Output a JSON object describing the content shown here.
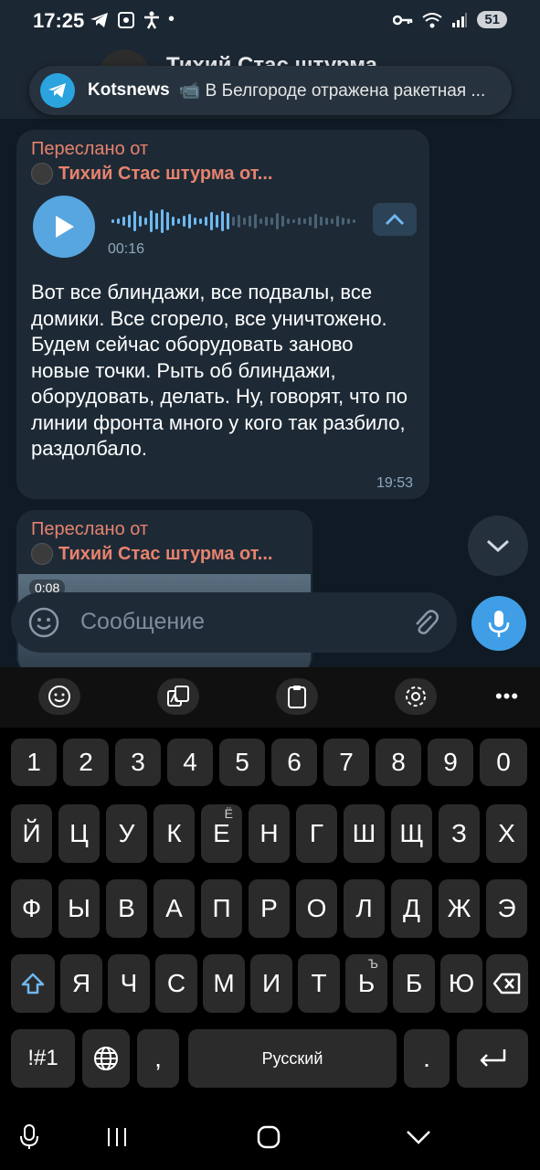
{
  "status": {
    "time": "17:25",
    "battery": "51"
  },
  "header": {
    "title": "Тихий Стас штурма..."
  },
  "notification": {
    "app": "Kotsnews",
    "text": "📹 В Белгороде отражена ракетная ..."
  },
  "messages": [
    {
      "forwarded_label": "Переслано от",
      "source": "Тихий Стас штурма от...",
      "voice_duration": "00:16",
      "text": "Вот все блиндажи, все подвалы, все домики. Все сгорело, все уничтожено. Будем сейчас оборудовать заново новые точки. Рыть об блиндажи, оборудовать, делать. Ну, говорят, что по линии фронта много у кого так разбило, раздолбало.",
      "time": "19:53"
    },
    {
      "forwarded_label": "Переслано от",
      "source": "Тихий Стас штурма от...",
      "video_duration": "0:08"
    }
  ],
  "input": {
    "placeholder": "Сообщение"
  },
  "keyboard": {
    "number_row": [
      "1",
      "2",
      "3",
      "4",
      "5",
      "6",
      "7",
      "8",
      "9",
      "0"
    ],
    "row1": [
      "Й",
      "Ц",
      "У",
      "К",
      "Е",
      "Н",
      "Г",
      "Ш",
      "Щ",
      "З",
      "Х"
    ],
    "row1_sup_e": "Ё",
    "row2": [
      "Ф",
      "Ы",
      "В",
      "А",
      "П",
      "Р",
      "О",
      "Л",
      "Д",
      "Ж",
      "Э"
    ],
    "row3": [
      "Я",
      "Ч",
      "С",
      "М",
      "И",
      "Т",
      "Ь",
      "Б",
      "Ю"
    ],
    "row3_sup_soft": "Ъ",
    "symbols_key": "!#1",
    "comma": ",",
    "space": "Русский",
    "period": "."
  },
  "colors": {
    "accent": "#3f9ee6",
    "forwarded": "#e7826d",
    "bubble": "#1d2a36"
  }
}
